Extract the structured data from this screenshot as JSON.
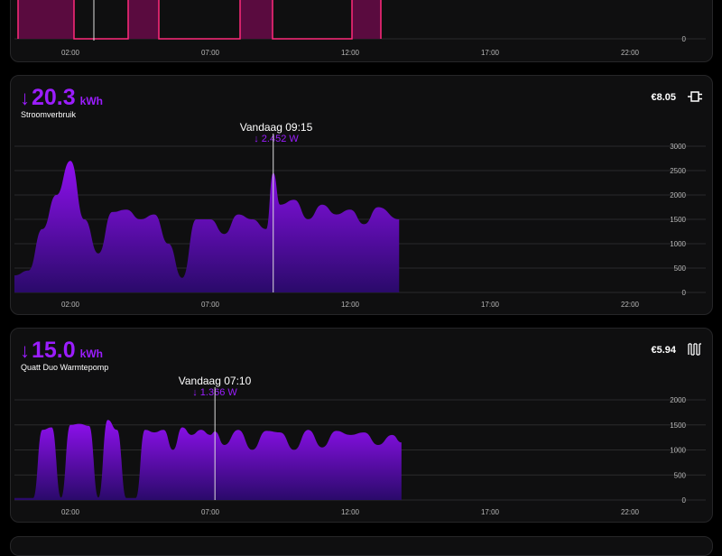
{
  "cards": [
    {
      "id": "top",
      "x_ticks": [
        "02:00",
        "07:00",
        "12:00",
        "17:00",
        "22:00"
      ],
      "y_ticks": [
        "0"
      ]
    },
    {
      "id": "stroom",
      "value": "20.3",
      "unit": "kWh",
      "title": "Stroomverbruik",
      "cost": "€8.05",
      "icon": "plug-icon",
      "tooltip_time": "Vandaag 09:15",
      "tooltip_value": "2.452 W",
      "x_ticks": [
        "02:00",
        "07:00",
        "12:00",
        "17:00",
        "22:00"
      ],
      "y_ticks": [
        "3000",
        "2500",
        "2000",
        "1500",
        "1000",
        "500",
        "0"
      ]
    },
    {
      "id": "quatt",
      "value": "15.0",
      "unit": "kWh",
      "title": "Quatt Duo Warmtepomp",
      "cost": "€5.94",
      "icon": "radiator-icon",
      "tooltip_time": "Vandaag 07:10",
      "tooltip_value": "1.366 W",
      "x_ticks": [
        "02:00",
        "07:00",
        "12:00",
        "17:00",
        "22:00"
      ],
      "y_ticks": [
        "2000",
        "1500",
        "1000",
        "500",
        "0"
      ]
    }
  ],
  "colors": {
    "accent": "#9b1dff",
    "fill_top": "#8a10e6",
    "fill_bottom": "#2a0a6a",
    "top_line": "#ff2a7a",
    "top_fill": "#5a0b3f",
    "grid": "#2a2a2c",
    "tick": "#b8b8b8"
  },
  "chart_data": [
    {
      "type": "area",
      "x": [
        "00:00",
        "00:30",
        "01:00",
        "01:30",
        "02:00",
        "02:30",
        "03:00",
        "03:30",
        "04:00",
        "04:30",
        "05:00",
        "05:30",
        "06:00",
        "06:30",
        "07:00",
        "07:30",
        "08:00",
        "08:30",
        "09:00",
        "09:15",
        "09:30",
        "10:00",
        "10:30",
        "11:00",
        "11:30",
        "12:00",
        "12:30",
        "13:00",
        "13:45"
      ],
      "values": [
        350,
        450,
        1300,
        2000,
        2700,
        1500,
        800,
        1650,
        1700,
        1500,
        1600,
        1000,
        300,
        1500,
        1500,
        1200,
        1600,
        1500,
        1300,
        2452,
        1800,
        1900,
        1500,
        1800,
        1600,
        1700,
        1400,
        1750,
        1500
      ],
      "ylim": [
        0,
        3000
      ],
      "xlim": [
        "00:00",
        "24:00"
      ]
    },
    {
      "type": "area",
      "x": [
        "00:00",
        "00:40",
        "01:00",
        "01:20",
        "01:40",
        "02:00",
        "02:20",
        "02:40",
        "03:00",
        "03:20",
        "03:40",
        "04:00",
        "04:20",
        "04:40",
        "05:00",
        "05:20",
        "05:40",
        "06:00",
        "06:20",
        "06:40",
        "07:00",
        "07:10",
        "07:30",
        "08:00",
        "08:30",
        "09:00",
        "09:30",
        "10:00",
        "10:30",
        "11:00",
        "11:30",
        "12:00",
        "12:30",
        "13:00",
        "13:30",
        "13:50"
      ],
      "values": [
        40,
        40,
        1400,
        1450,
        50,
        1500,
        1520,
        1480,
        50,
        1600,
        1400,
        40,
        40,
        1400,
        1350,
        1400,
        1000,
        1450,
        1300,
        1400,
        1300,
        1366,
        1100,
        1400,
        1000,
        1380,
        1350,
        1000,
        1400,
        1050,
        1380,
        1300,
        1350,
        1100,
        1300,
        1150
      ],
      "ylim": [
        0,
        2000
      ],
      "xlim": [
        "00:00",
        "24:00"
      ]
    }
  ]
}
